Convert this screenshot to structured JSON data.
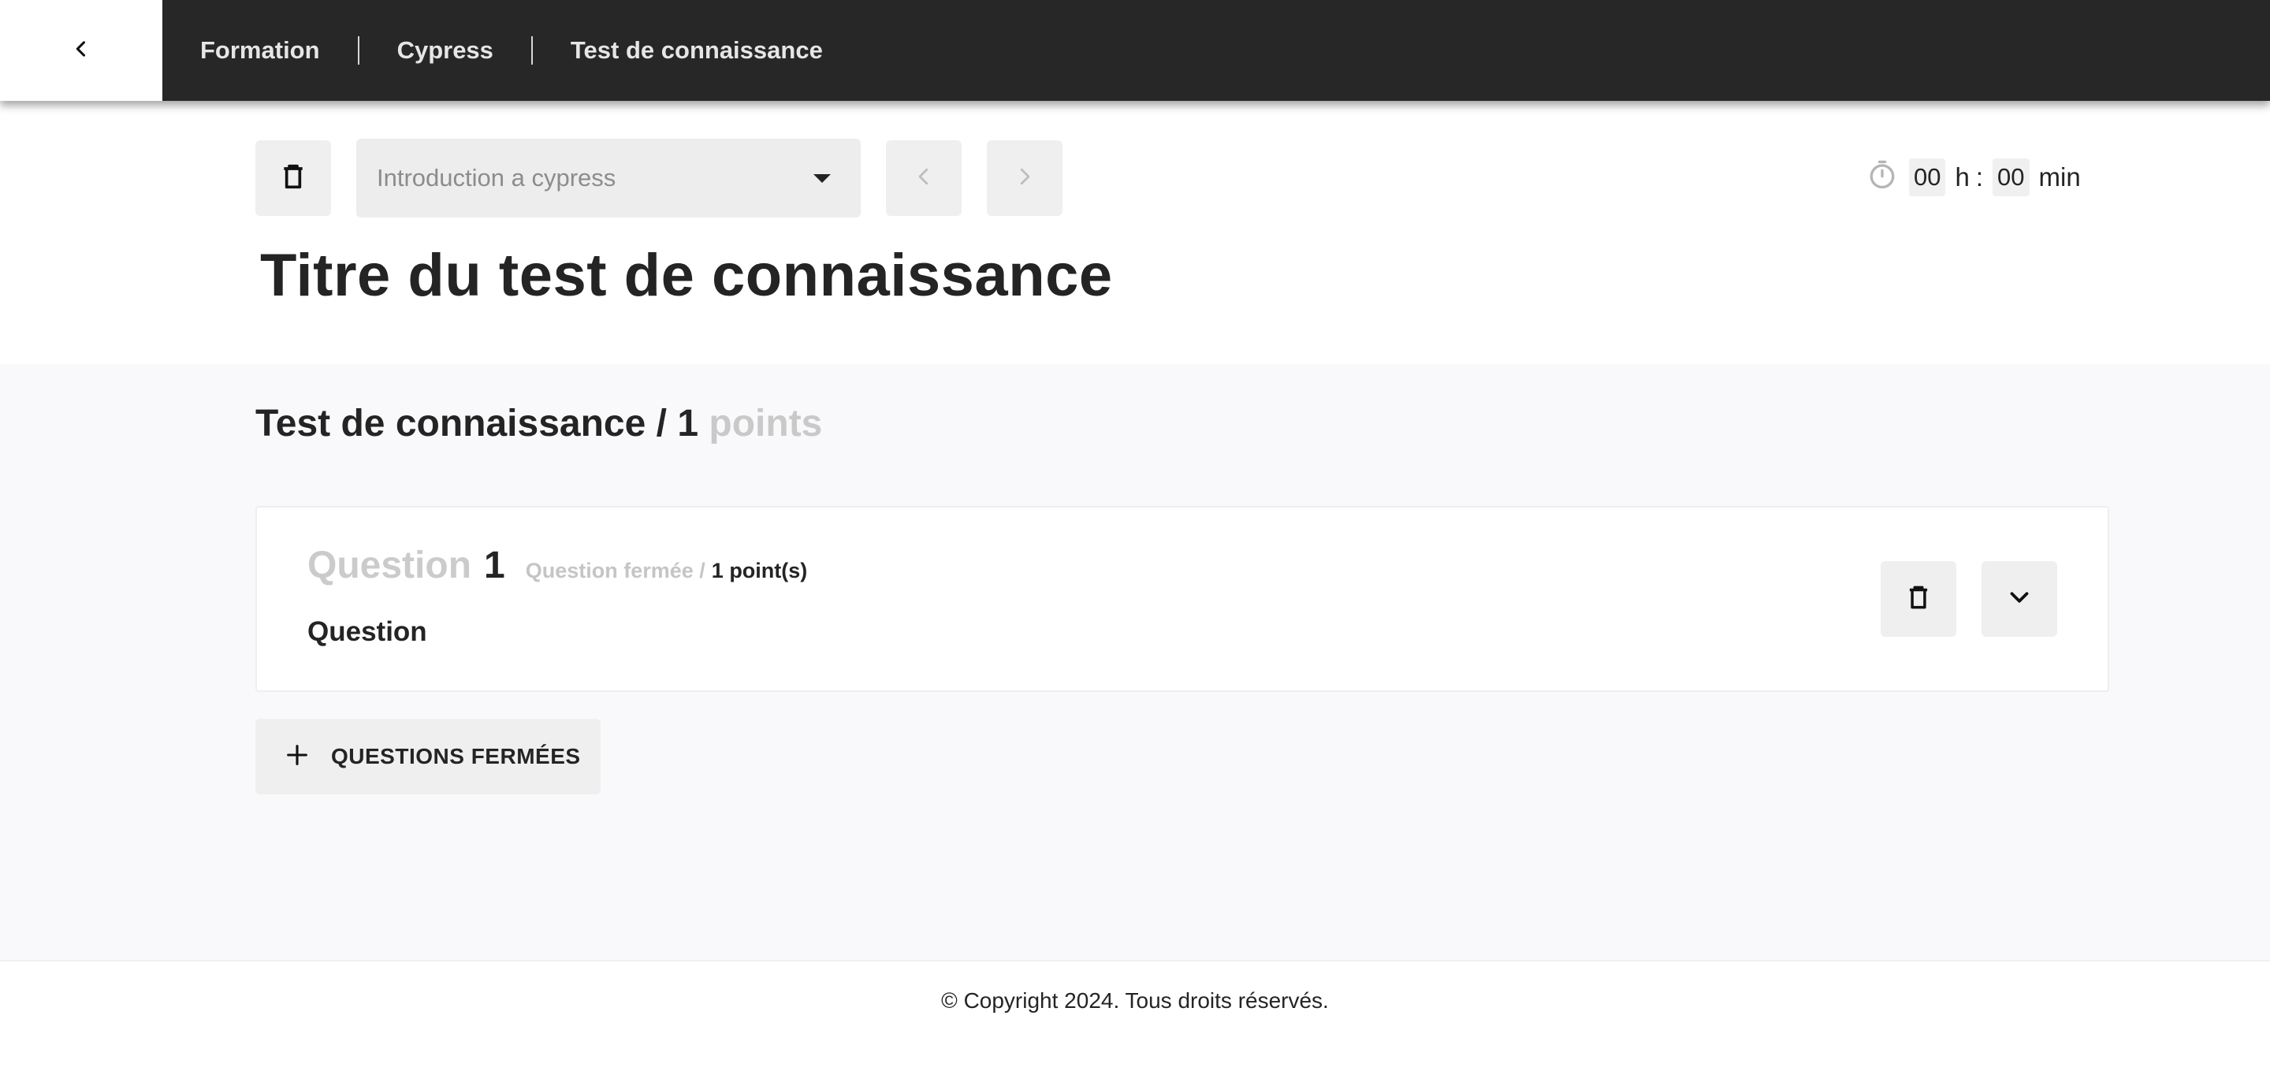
{
  "header": {
    "back_icon": "chevron-left-icon",
    "breadcrumbs": [
      "Formation",
      "Cypress",
      "Test de connaissance"
    ]
  },
  "toolbar": {
    "delete_icon": "trash-icon",
    "module_select": {
      "value": "Introduction a cypress",
      "options_icon": "caret-down-icon"
    },
    "prev_icon": "chevron-left-icon",
    "next_icon": "chevron-right-icon"
  },
  "timer": {
    "icon": "stopwatch-icon",
    "hours": "00",
    "hours_unit": "h",
    "separator": ":",
    "minutes": "00",
    "minutes_unit": "min"
  },
  "page": {
    "title": "Titre du test de connaissance"
  },
  "section": {
    "title": "Test de connaissance",
    "slash": "/",
    "total_points": "1",
    "points_label": "points"
  },
  "questions": [
    {
      "label": "Question",
      "number": "1",
      "type": "Question fermée /",
      "points": "1 point(s)",
      "text": "Question"
    }
  ],
  "actions": {
    "add_closed_label": "QUESTIONS FERMÉES"
  },
  "footer": {
    "copyright": "© Copyright 2024. Tous droits réservés."
  },
  "colors": {
    "header_bg": "#272727",
    "content_bg": "#f9f9fb",
    "button_bg": "#efefef",
    "text": "#242424",
    "muted": "#c9c9c9"
  }
}
